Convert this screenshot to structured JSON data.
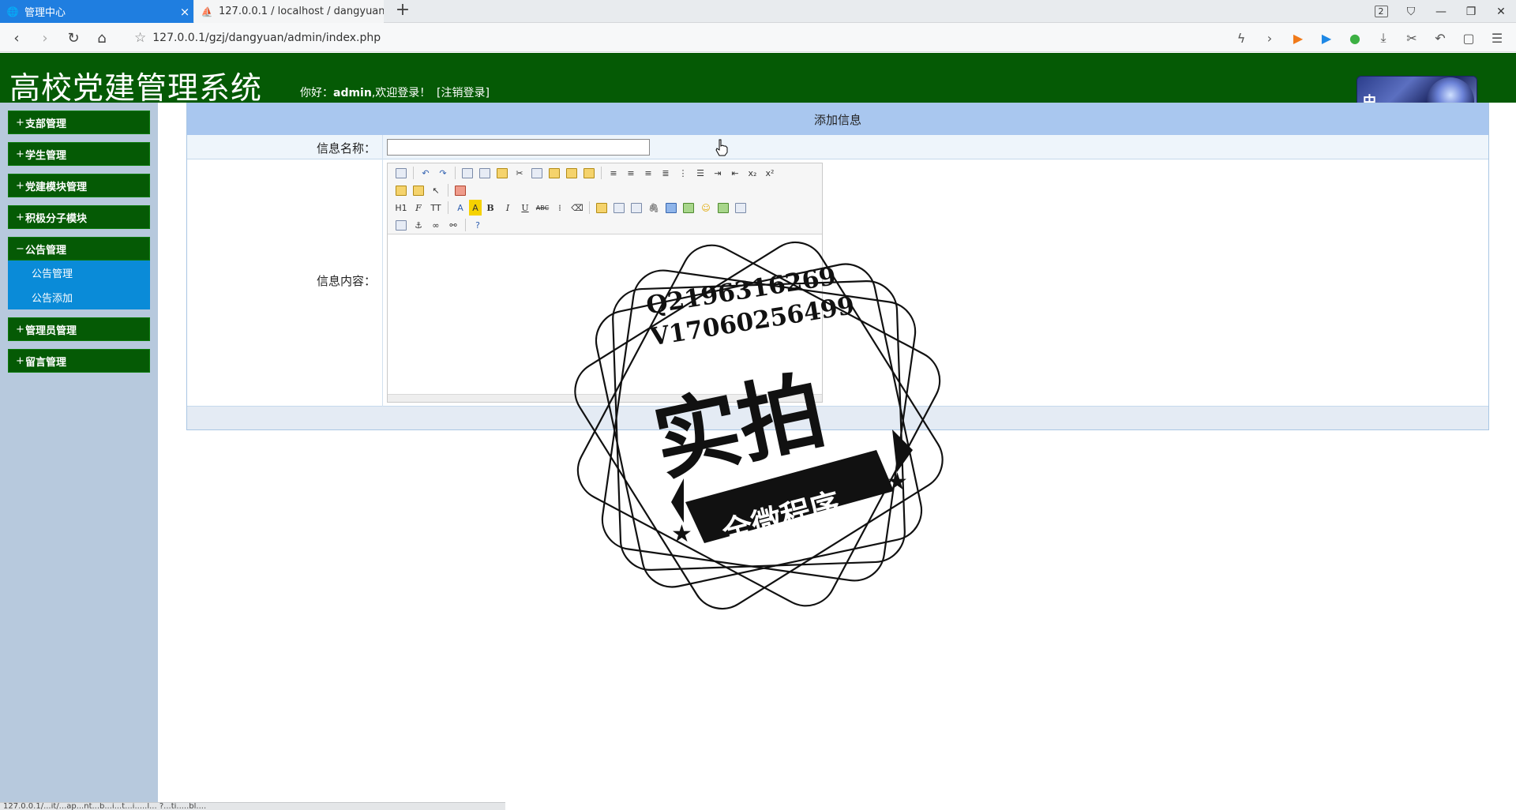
{
  "browser": {
    "tabs": [
      {
        "label": "管理中心",
        "icon": "globe-icon",
        "active": true
      },
      {
        "label": "127.0.0.1 / localhost / dangyuan / ...",
        "icon": "phpmyadmin-icon",
        "active": false
      }
    ],
    "new_tab_label": "+",
    "window_badge": "2",
    "url": "127.0.0.1/gzj/dangyuan/admin/index.php",
    "status_url": "127.0.0.1/...it/...ap...nt...b...i...t...i.....l... ?...ti.....bl...."
  },
  "header": {
    "title": "高校党建管理系统",
    "greeting_prefix": "你好：",
    "username": "admin",
    "greeting_suffix": ",欢迎登录！",
    "logout_label": "[注销登录]",
    "corner_badge": "中"
  },
  "sidebar": {
    "groups": [
      {
        "label": "支部管理",
        "expanded": false,
        "sign": "+"
      },
      {
        "label": "学生管理",
        "expanded": false,
        "sign": "+"
      },
      {
        "label": "党建模块管理",
        "expanded": false,
        "sign": "+"
      },
      {
        "label": "积极分子模块",
        "expanded": false,
        "sign": "+"
      },
      {
        "label": "公告管理",
        "expanded": true,
        "sign": "−",
        "items": [
          "公告管理",
          "公告添加"
        ]
      },
      {
        "label": "管理员管理",
        "expanded": false,
        "sign": "+"
      },
      {
        "label": "留言管理",
        "expanded": false,
        "sign": "+"
      }
    ]
  },
  "form": {
    "heading": "添加信息",
    "name_label": "信息名称：",
    "name_value": "",
    "content_label": "信息内容：",
    "toolbar": {
      "heading_btn": "H1",
      "font_btn": "F",
      "size_btn": "TT",
      "bold": "B",
      "italic": "I",
      "underline": "U",
      "strike": "ABC",
      "subscript": "x₂",
      "superscript": "x²"
    }
  },
  "watermark": {
    "line1": "Q2196316269",
    "line2": "V17060256499",
    "big": "实拍",
    "ribbon": "全微程序"
  }
}
